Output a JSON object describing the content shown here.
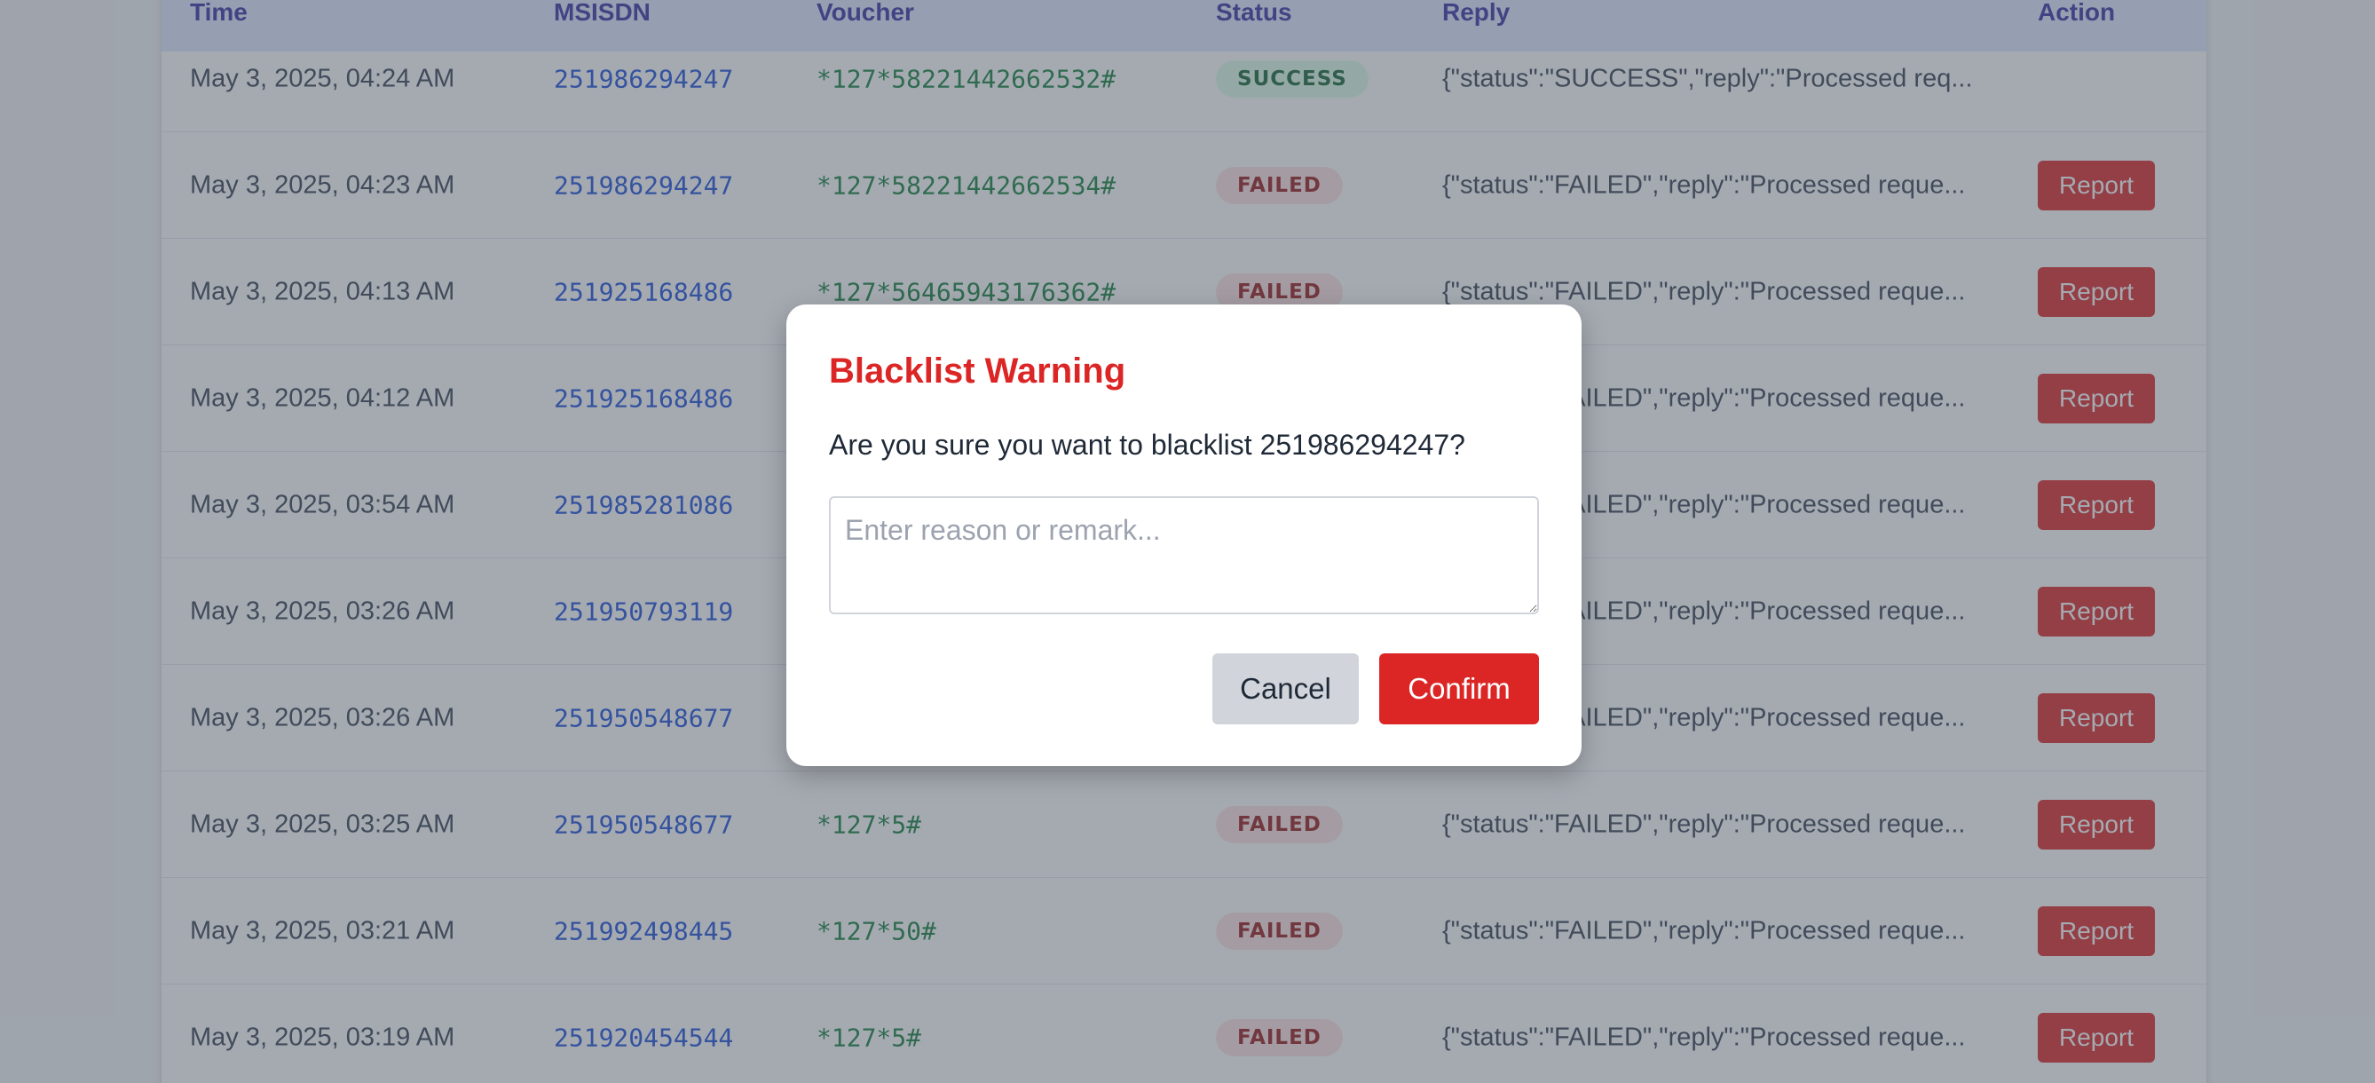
{
  "table": {
    "headers": {
      "time": "Time",
      "msisdn": "MSISDN",
      "voucher": "Voucher",
      "status": "Status",
      "reply": "Reply",
      "action": "Action"
    },
    "rows": [
      {
        "time": "May 3, 2025, 04:24 AM",
        "msisdn": "251986294247",
        "voucher": "*127*58221442662532#",
        "status": "SUCCESS",
        "reply": "{\"status\":\"SUCCESS\",\"reply\":\"Processed req...",
        "action": ""
      },
      {
        "time": "May 3, 2025, 04:23 AM",
        "msisdn": "251986294247",
        "voucher": "*127*58221442662534#",
        "status": "FAILED",
        "reply": "{\"status\":\"FAILED\",\"reply\":\"Processed reque...",
        "action": "Report"
      },
      {
        "time": "May 3, 2025, 04:13 AM",
        "msisdn": "251925168486",
        "voucher": "*127*56465943176362#",
        "status": "FAILED",
        "reply": "{\"status\":\"FAILED\",\"reply\":\"Processed reque...",
        "action": "Report"
      },
      {
        "time": "May 3, 2025, 04:12 AM",
        "msisdn": "251925168486",
        "voucher": "",
        "status": "",
        "reply": "{\"status\":\"FAILED\",\"reply\":\"Processed reque...",
        "action": "Report"
      },
      {
        "time": "May 3, 2025, 03:54 AM",
        "msisdn": "251985281086",
        "voucher": "",
        "status": "",
        "reply": "{\"status\":\"FAILED\",\"reply\":\"Processed reque...",
        "action": "Report"
      },
      {
        "time": "May 3, 2025, 03:26 AM",
        "msisdn": "251950793119",
        "voucher": "",
        "status": "",
        "reply": "{\"status\":\"FAILED\",\"reply\":\"Processed reque...",
        "action": "Report"
      },
      {
        "time": "May 3, 2025, 03:26 AM",
        "msisdn": "251950548677",
        "voucher": "",
        "status": "",
        "reply": "{\"status\":\"FAILED\",\"reply\":\"Processed reque...",
        "action": "Report"
      },
      {
        "time": "May 3, 2025, 03:25 AM",
        "msisdn": "251950548677",
        "voucher": "*127*5#",
        "status": "FAILED",
        "reply": "{\"status\":\"FAILED\",\"reply\":\"Processed reque...",
        "action": "Report"
      },
      {
        "time": "May 3, 2025, 03:21 AM",
        "msisdn": "251992498445",
        "voucher": "*127*50#",
        "status": "FAILED",
        "reply": "{\"status\":\"FAILED\",\"reply\":\"Processed reque...",
        "action": "Report"
      },
      {
        "time": "May 3, 2025, 03:19 AM",
        "msisdn": "251920454544",
        "voucher": "*127*5#",
        "status": "FAILED",
        "reply": "{\"status\":\"FAILED\",\"reply\":\"Processed reque...",
        "action": "Report"
      }
    ]
  },
  "modal": {
    "title": "Blacklist Warning",
    "message": "Are you sure you want to blacklist 251986294247?",
    "remark_placeholder": "Enter reason or remark...",
    "remark_value": "",
    "cancel_label": "Cancel",
    "confirm_label": "Confirm"
  },
  "colors": {
    "accent_red": "#dc2626",
    "header_bg": "#e0e7ff",
    "header_text": "#3730a3",
    "msisdn_blue": "#1d4ed8",
    "voucher_green": "#15803d",
    "success_bg": "#dcfce7",
    "failed_bg": "#fee2e2"
  }
}
